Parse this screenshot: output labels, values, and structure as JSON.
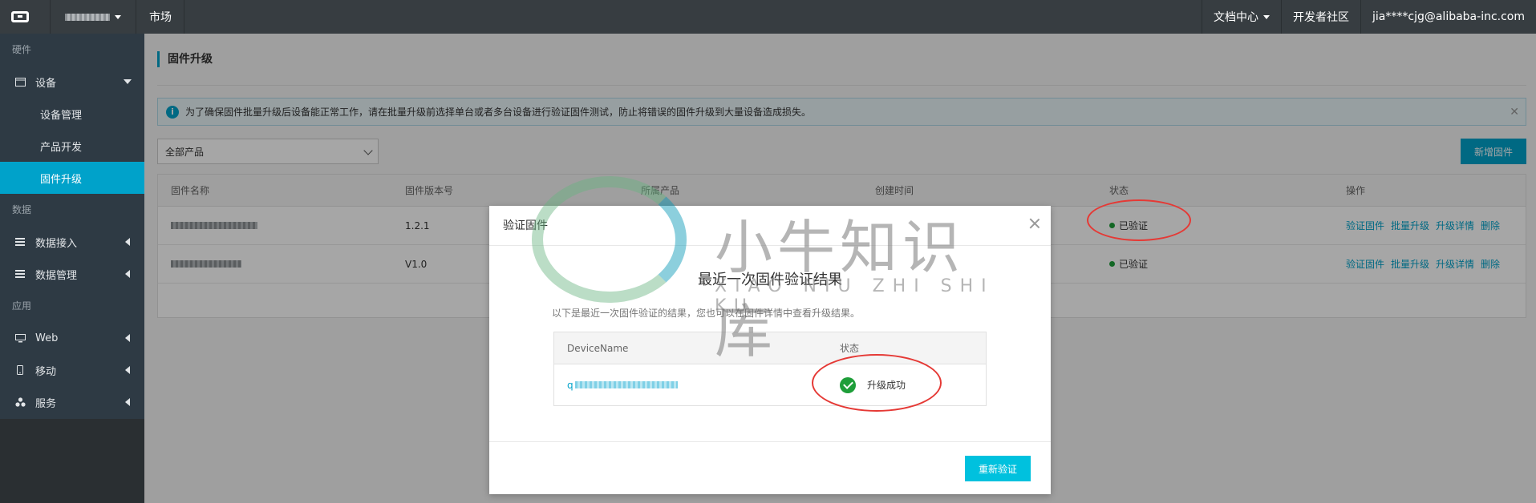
{
  "topbar": {
    "market": "市场",
    "docs": "文档中心",
    "community": "开发者社区",
    "user": "jia****cjg@alibaba-inc.com"
  },
  "sidebar": {
    "section_hardware": "硬件",
    "device": "设备",
    "device_manage": "设备管理",
    "product_dev": "产品开发",
    "firmware_upgrade": "固件升级",
    "section_data": "数据",
    "data_access": "数据接入",
    "data_manage": "数据管理",
    "section_app": "应用",
    "web": "Web",
    "mobile": "移动",
    "service": "服务"
  },
  "main": {
    "title": "固件升级",
    "notice": "为了确保固件批量升级后设备能正常工作，请在批量升级前选择单台或者多台设备进行验证固件测试，防止将错误的固件升级到大量设备造成损失。",
    "product_select": "全部产品",
    "add_button": "新增固件",
    "columns": [
      "固件名称",
      "固件版本号",
      "所属产品",
      "创建时间",
      "状态",
      "操作"
    ],
    "rows": [
      {
        "version": "1.2.1",
        "status": "已验证"
      },
      {
        "version": "V1.0",
        "status": "已验证"
      }
    ],
    "ops": {
      "verify": "验证固件",
      "batch": "批量升级",
      "detail": "升级详情",
      "delete": "删除"
    }
  },
  "modal": {
    "title": "验证固件",
    "result_title": "最近一次固件验证结果",
    "result_desc": "以下是最近一次固件验证的结果，您也可以在固件详情中查看升级结果。",
    "col_device": "DeviceName",
    "col_status": "状态",
    "device_prefix": "q",
    "result_status": "升级成功",
    "reverify_button": "重新验证"
  },
  "watermark": {
    "text": "小牛知识库",
    "sub": "XIAO NIU ZHI SHI KU"
  },
  "colors": {
    "accent": "#00a2ca",
    "success": "#1e9e39",
    "annotation": "#e53935"
  }
}
